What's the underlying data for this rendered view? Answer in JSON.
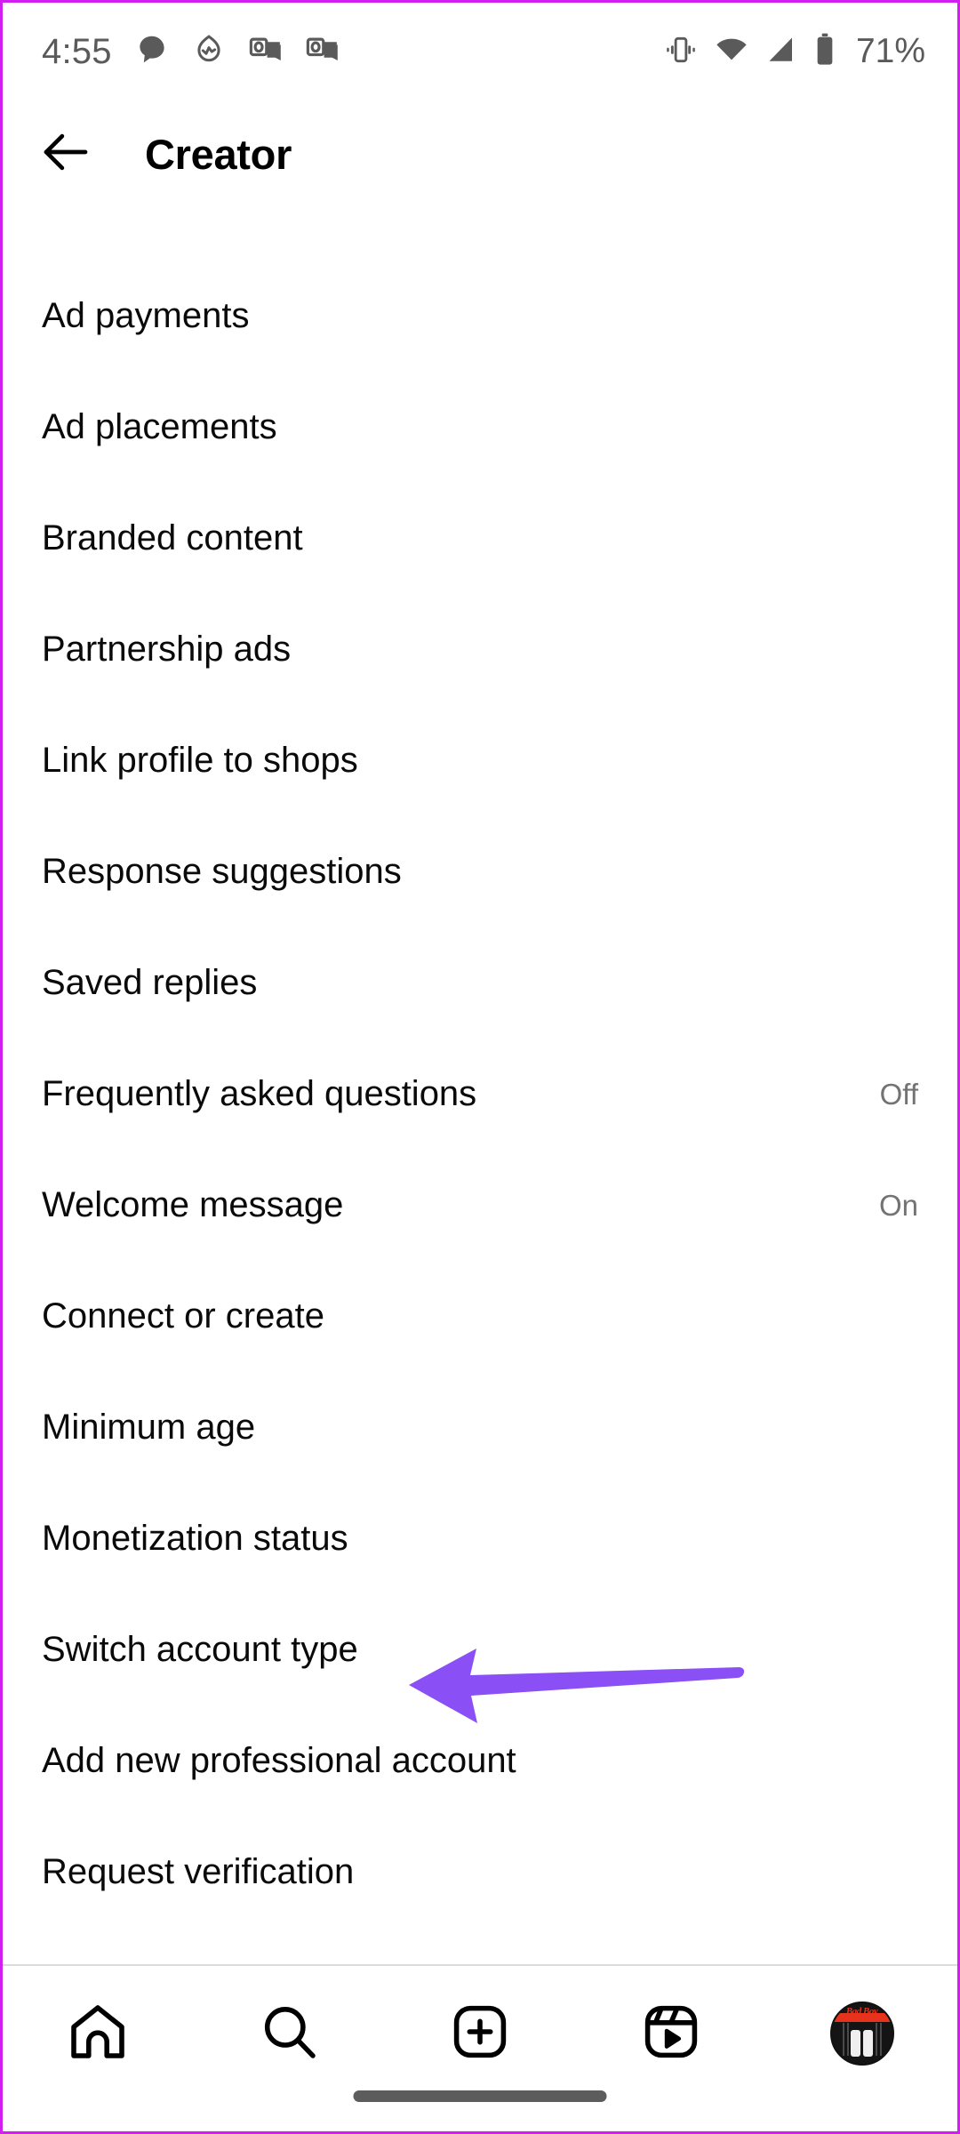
{
  "status_bar": {
    "time": "4:55",
    "battery_percent": "71%",
    "left_icons": [
      "messages-bubble-icon",
      "health-activity-icon",
      "outlook-icon",
      "outlook-icon"
    ],
    "right_icons": [
      "vibrate-icon",
      "wifi-icon",
      "cellular-signal-icon",
      "battery-icon"
    ]
  },
  "header": {
    "back_icon": "back-arrow-icon",
    "title": "Creator"
  },
  "menu": {
    "items": [
      {
        "label": "Ad payments",
        "value": ""
      },
      {
        "label": "Ad placements",
        "value": ""
      },
      {
        "label": "Branded content",
        "value": ""
      },
      {
        "label": "Partnership ads",
        "value": ""
      },
      {
        "label": "Link profile to shops",
        "value": ""
      },
      {
        "label": "Response suggestions",
        "value": ""
      },
      {
        "label": "Saved replies",
        "value": ""
      },
      {
        "label": "Frequently asked questions",
        "value": "Off"
      },
      {
        "label": "Welcome message",
        "value": "On"
      },
      {
        "label": "Connect or create",
        "value": ""
      },
      {
        "label": "Minimum age",
        "value": ""
      },
      {
        "label": "Monetization status",
        "value": ""
      },
      {
        "label": "Switch account type",
        "value": ""
      },
      {
        "label": "Add new professional account",
        "value": ""
      },
      {
        "label": "Request verification",
        "value": ""
      }
    ]
  },
  "annotation": {
    "type": "arrow-left",
    "color": "#8A4FF5",
    "points_to": "Switch account type"
  },
  "bottom_nav": {
    "items": [
      {
        "icon": "home-icon",
        "label": "Home"
      },
      {
        "icon": "search-icon",
        "label": "Search"
      },
      {
        "icon": "create-plus-icon",
        "label": "Create"
      },
      {
        "icon": "reels-icon",
        "label": "Reels"
      },
      {
        "icon": "profile-avatar",
        "label": "Profile"
      }
    ]
  },
  "colors": {
    "accent": "#8A4FF5",
    "screenshot_border": "#d21ef0",
    "text_primary": "#0a0a0a",
    "text_secondary": "#737373"
  }
}
